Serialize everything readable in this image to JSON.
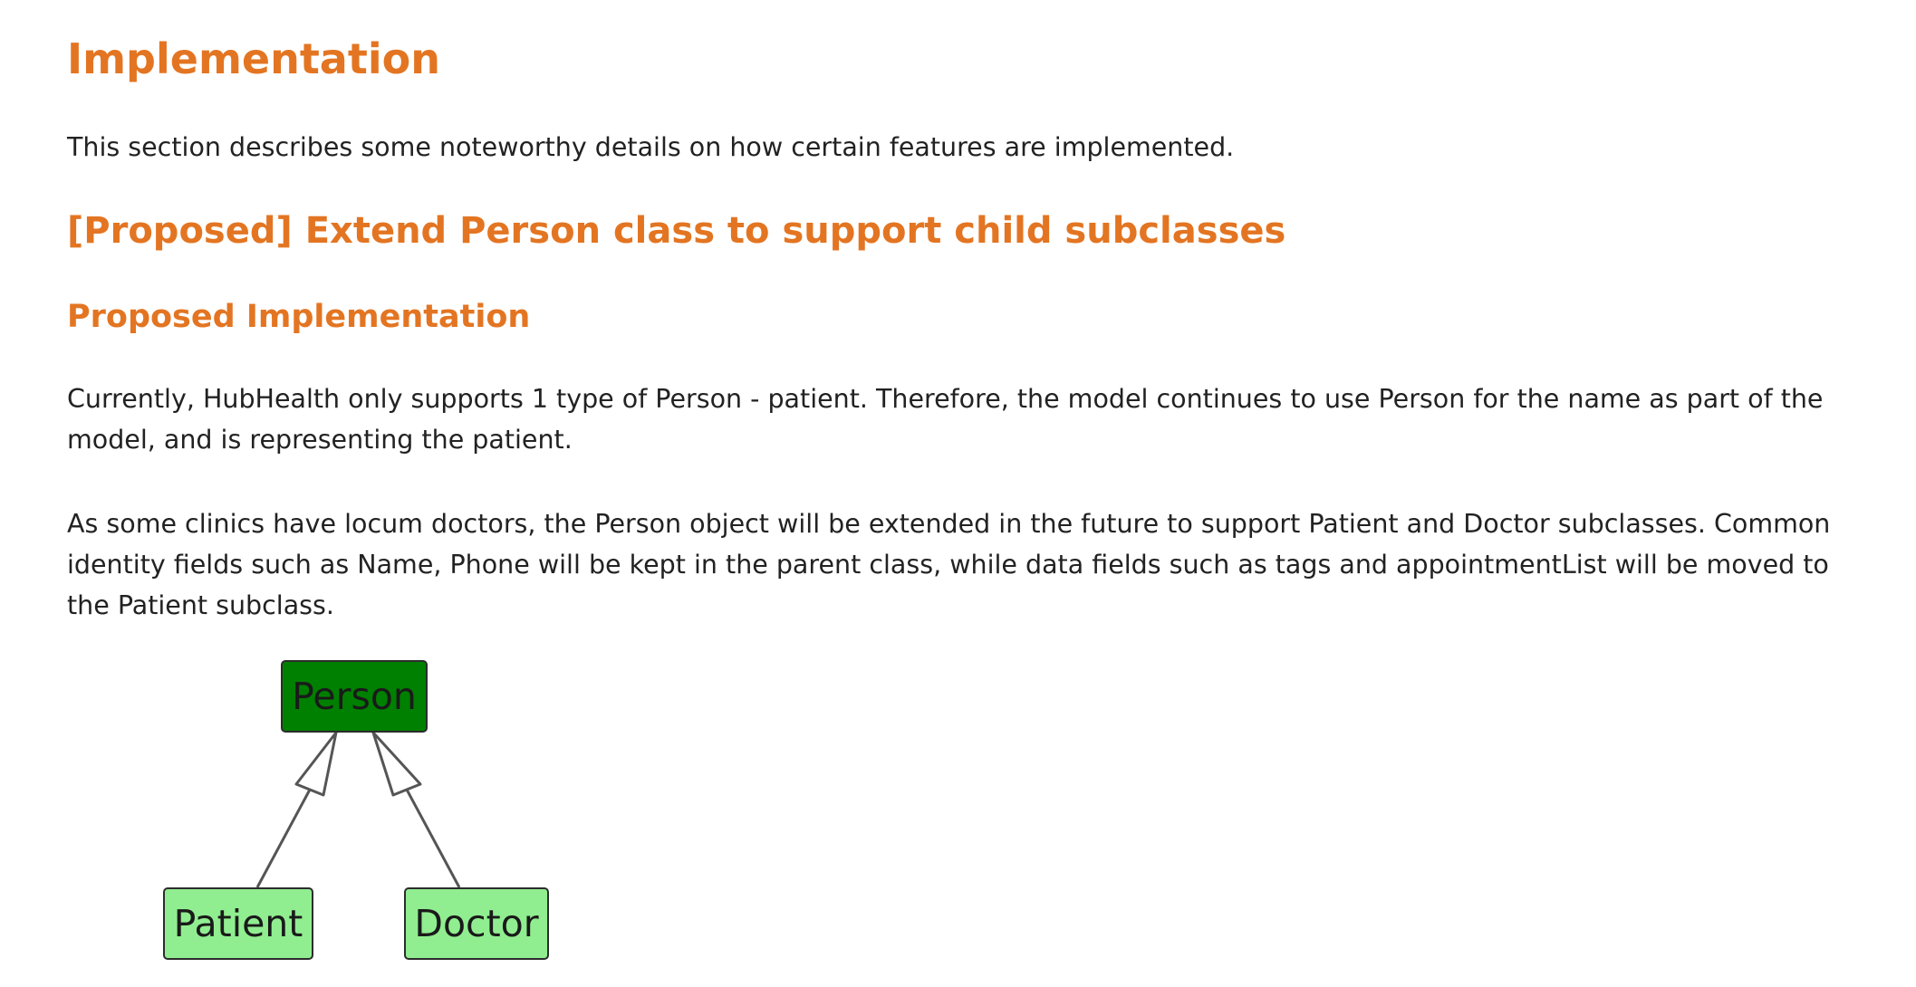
{
  "headings": {
    "implementation": "Implementation",
    "proposed_feature": "[Proposed] Extend Person class to support child subclasses",
    "proposed_implementation": "Proposed Implementation"
  },
  "paragraphs": {
    "intro": "This section describes some noteworthy details on how certain features are implemented.",
    "current": "Currently, HubHealth only supports 1 type of Person - patient. Therefore, the model continues to use Person for the name as part of the model, and is representing the patient.",
    "future": "As some clinics have locum doctors, the Person object will be extended in the future to support Patient and Doctor subclasses. Common identity fields such as Name, Phone will be kept in the parent class, while data fields such as tags and appointmentList will be moved to the Patient subclass."
  },
  "diagram": {
    "classes": {
      "parent": "Person",
      "child_left": "Patient",
      "child_right": "Doctor"
    },
    "colors": {
      "parent_fill": "#008000",
      "child_fill": "#90ee90",
      "heading": "#e37522"
    }
  }
}
